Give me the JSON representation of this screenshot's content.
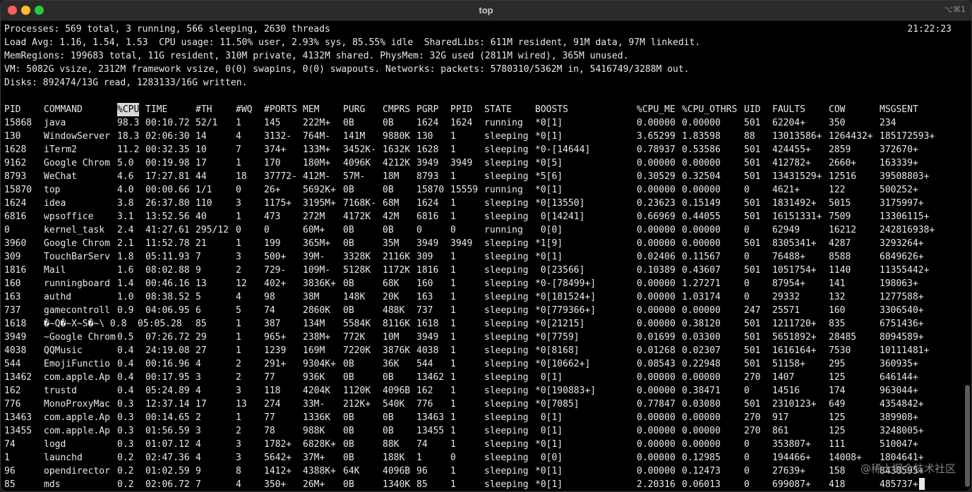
{
  "window": {
    "title": "top",
    "shortcut": "⌥⌘1"
  },
  "summary": {
    "processes": "Processes: 569 total, 3 running, 566 sleeping, 2630 threads",
    "clock": "21:22:23",
    "load": "Load Avg: 1.16, 1.54, 1.53  CPU usage: 11.50% user, 2.93% sys, 85.55% idle  SharedLibs: 611M resident, 91M data, 97M linkedit.",
    "memregions": "MemRegions: 199683 total, 11G resident, 310M private, 4132M shared. PhysMem: 32G used (2811M wired), 365M unused.",
    "vm": "VM: 5082G vsize, 2312M framework vsize, 0(0) swapins, 0(0) swapouts. Networks: packets: 5780310/5362M in, 5416749/3288M out.",
    "disks": "Disks: 892474/13G read, 1283133/16G written."
  },
  "table": {
    "headers": [
      "PID",
      "COMMAND",
      "%CPU",
      "TIME",
      "#TH",
      "#WQ",
      "#PORTS",
      "MEM",
      "PURG",
      "CMPRS",
      "PGRP",
      "PPID",
      "STATE",
      "BOOSTS",
      "%CPU_ME",
      "%CPU_OTHRS",
      "UID",
      "FAULTS",
      "COW",
      "MSGSENT"
    ],
    "sorted_column": "%CPU",
    "rows": [
      [
        "15868",
        "java",
        "98.3",
        "00:10.72",
        "52/1",
        "1",
        "145",
        "222M+",
        "0B",
        "0B",
        "1624",
        "1624",
        "running",
        "*0[1]",
        "0.00000",
        "0.00000",
        "501",
        "62204+",
        "350",
        "234"
      ],
      [
        "130",
        "WindowServer",
        "18.3",
        "02:06:30",
        "14",
        "4",
        "3132-",
        "764M-",
        "141M",
        "9880K",
        "130",
        "1",
        "sleeping",
        "*0[1]",
        "3.65299",
        "1.83598",
        "88",
        "13013586+",
        "1264432+",
        "185172593+"
      ],
      [
        "1628",
        "iTerm2",
        "11.2",
        "00:32.35",
        "10",
        "7",
        "374+",
        "133M+",
        "3452K-",
        "1632K",
        "1628",
        "1",
        "sleeping",
        "*0-[14644]",
        "0.78937",
        "0.53586",
        "501",
        "424455+",
        "2859",
        "372670+"
      ],
      [
        "9162",
        "Google Chrom",
        "5.0",
        "00:19.98",
        "17",
        "1",
        "170",
        "180M+",
        "4096K",
        "4212K",
        "3949",
        "3949",
        "sleeping",
        "*0[5]",
        "0.00000",
        "0.00000",
        "501",
        "412782+",
        "2660+",
        "163339+"
      ],
      [
        "8793",
        "WeChat",
        "4.6",
        "17:27.81",
        "44",
        "18",
        "37772-",
        "412M-",
        "57M-",
        "18M",
        "8793",
        "1",
        "sleeping",
        "*5[6]",
        "0.30529",
        "0.32504",
        "501",
        "13431529+",
        "12516",
        "39508803+"
      ],
      [
        "15870",
        "top",
        "4.0",
        "00:00.66",
        "1/1",
        "0",
        "26+",
        "5692K+",
        "0B",
        "0B",
        "15870",
        "15559",
        "running",
        "*0[1]",
        "0.00000",
        "0.00000",
        "0",
        "4621+",
        "122",
        "500252+"
      ],
      [
        "1624",
        "idea",
        "3.8",
        "26:37.80",
        "110",
        "3",
        "1175+",
        "3195M+",
        "7168K-",
        "68M",
        "1624",
        "1",
        "sleeping",
        "*0[13550]",
        "0.23623",
        "0.15149",
        "501",
        "1831492+",
        "5015",
        "3175997+"
      ],
      [
        "6816",
        "wpsoffice",
        "3.1",
        "13:52.56",
        "40",
        "1",
        "473",
        "272M",
        "4172K",
        "42M",
        "6816",
        "1",
        "sleeping",
        " 0[14241]",
        "0.66969",
        "0.44055",
        "501",
        "16151331+",
        "7509",
        "13306115+"
      ],
      [
        "0",
        "kernel_task",
        "2.4",
        "41:27.61",
        "295/12",
        "0",
        "0",
        "60M+",
        "0B",
        "0B",
        "0",
        "0",
        "running",
        " 0[0]",
        "0.00000",
        "0.00000",
        "0",
        "62949",
        "16212",
        "242816938+"
      ],
      [
        "3960",
        "Google Chrom",
        "2.1",
        "11:52.78",
        "21",
        "1",
        "199",
        "365M+",
        "0B",
        "35M",
        "3949",
        "3949",
        "sleeping",
        "*1[9]",
        "0.00000",
        "0.00000",
        "501",
        "8305341+",
        "4287",
        "3293264+"
      ],
      [
        "309",
        "TouchBarServ",
        "1.8",
        "05:11.93",
        "7",
        "3",
        "500+",
        "39M-",
        "3328K",
        "2116K",
        "309",
        "1",
        "sleeping",
        "*0[1]",
        "0.02406",
        "0.11567",
        "0",
        "76488+",
        "8588",
        "6849626+"
      ],
      [
        "1816",
        "Mail",
        "1.6",
        "08:02.88",
        "9",
        "2",
        "729-",
        "109M-",
        "5128K",
        "1172K",
        "1816",
        "1",
        "sleeping",
        " 0[23566]",
        "0.10389",
        "0.43607",
        "501",
        "1051754+",
        "1140",
        "11355442+"
      ],
      [
        "160",
        "runningboard",
        "1.4",
        "00:46.16",
        "13",
        "12",
        "402+",
        "3836K+",
        "0B",
        "68K",
        "160",
        "1",
        "sleeping",
        "*0-[78499+]",
        "0.00000",
        "1.27271",
        "0",
        "87954+",
        "141",
        "198063+"
      ],
      [
        "163",
        "authd",
        "1.0",
        "08:38.52",
        "5",
        "4",
        "98",
        "38M",
        "148K",
        "20K",
        "163",
        "1",
        "sleeping",
        "*0[181524+]",
        "0.00000",
        "1.03174",
        "0",
        "29332",
        "132",
        "1277588+"
      ],
      [
        "737",
        "gamecontroll",
        "0.9",
        "04:06.95",
        "6",
        "5",
        "74",
        "2860K",
        "0B",
        "488K",
        "737",
        "1",
        "sleeping",
        "*0[779366+]",
        "0.00000",
        "0.00000",
        "247",
        "25571",
        "160",
        "3306540+"
      ],
      [
        "1618",
        "�~Q�~X~S�~\\ 0.8  05:05.28",
        "",
        "",
        "85",
        "1",
        "387",
        "134M",
        "5584K",
        "8116K",
        "1618",
        "1",
        "sleeping",
        "*0[21215]",
        "0.00000",
        "0.38120",
        "501",
        "1211720+",
        "835",
        "6751436+"
      ],
      [
        "3949",
        "~Google Chrom",
        "0.5",
        "07:26.72",
        "29",
        "1",
        "965+",
        "238M+",
        "772K",
        "10M",
        "3949",
        "1",
        "sleeping",
        "*0[7759]",
        "0.01699",
        "0.03300",
        "501",
        "5651892+",
        "28485",
        "8094589+"
      ],
      [
        "4038",
        "QQMusic",
        "0.4",
        "24:19.08",
        "27",
        "1",
        "1239",
        "169M",
        "7220K",
        "3876K",
        "4038",
        "1",
        "sleeping",
        "*0[8168]",
        "0.01268",
        "0.02307",
        "501",
        "1616164+",
        "7530",
        "10111481+"
      ],
      [
        "544",
        "EmojiFunctio",
        "0.4",
        "00:16.96",
        "4",
        "2",
        "291+",
        "9304K+",
        "0B",
        "36K",
        "544",
        "1",
        "sleeping",
        "*0[10662+]",
        "0.08543",
        "0.22948",
        "501",
        "51158+",
        "295",
        "360935+"
      ],
      [
        "13462",
        "com.apple.Ap",
        "0.4",
        "00:17.95",
        "3",
        "2",
        "77",
        "936K",
        "0B",
        "0B",
        "13462",
        "1",
        "sleeping",
        " 0[1]",
        "0.00000",
        "0.00000",
        "270",
        "1407",
        "125",
        "646144+"
      ],
      [
        "162",
        "trustd",
        "0.4",
        "05:24.89",
        "4",
        "3",
        "118",
        "4204K",
        "1120K",
        "4096B",
        "162",
        "1",
        "sleeping",
        "*0[190883+]",
        "0.00000",
        "0.38471",
        "0",
        "14516",
        "174",
        "963044+"
      ],
      [
        "776",
        "MonoProxyMac",
        "0.3",
        "12:37.14",
        "17",
        "13",
        "274",
        "33M-",
        "212K+",
        "540K",
        "776",
        "1",
        "sleeping",
        "*0[7085]",
        "0.77847",
        "0.03080",
        "501",
        "2310123+",
        "649",
        "4354842+"
      ],
      [
        "13463",
        "com.apple.Ap",
        "0.3",
        "00:14.65",
        "2",
        "1",
        "77",
        "1336K",
        "0B",
        "0B",
        "13463",
        "1",
        "sleeping",
        " 0[1]",
        "0.00000",
        "0.00000",
        "270",
        "917",
        "125",
        "389908+"
      ],
      [
        "13455",
        "com.apple.Ap",
        "0.3",
        "01:56.59",
        "3",
        "2",
        "78",
        "988K",
        "0B",
        "0B",
        "13455",
        "1",
        "sleeping",
        " 0[1]",
        "0.00000",
        "0.00000",
        "270",
        "861",
        "125",
        "3248005+"
      ],
      [
        "74",
        "logd",
        "0.3",
        "01:07.12",
        "4",
        "3",
        "1782+",
        "6828K+",
        "0B",
        "88K",
        "74",
        "1",
        "sleeping",
        "*0[1]",
        "0.00000",
        "0.00000",
        "0",
        "353807+",
        "111",
        "510047+"
      ],
      [
        "1",
        "launchd",
        "0.2",
        "02:47.36",
        "4",
        "3",
        "5642+",
        "37M+",
        "0B",
        "188K",
        "1",
        "0",
        "sleeping",
        " 0[0]",
        "0.00000",
        "0.12985",
        "0",
        "194466+",
        "14008+",
        "1804641+"
      ],
      [
        "96",
        "opendirector",
        "0.2",
        "01:02.59",
        "9",
        "8",
        "1412+",
        "4388K+",
        "64K",
        "4096B",
        "96",
        "1",
        "sleeping",
        "*0[1]",
        "0.00000",
        "0.12473",
        "0",
        "27639+",
        "158",
        "8438595+"
      ],
      [
        "85",
        "mds",
        "0.2",
        "02:06.72",
        "7",
        "4",
        "350+",
        "26M+",
        "0B",
        "1340K",
        "85",
        "1",
        "sleeping",
        "*0[1]",
        "2.20316",
        "0.06013",
        "0",
        "699087+",
        "418",
        "485737+"
      ]
    ]
  },
  "watermark": "@稀土掘金技术社区"
}
